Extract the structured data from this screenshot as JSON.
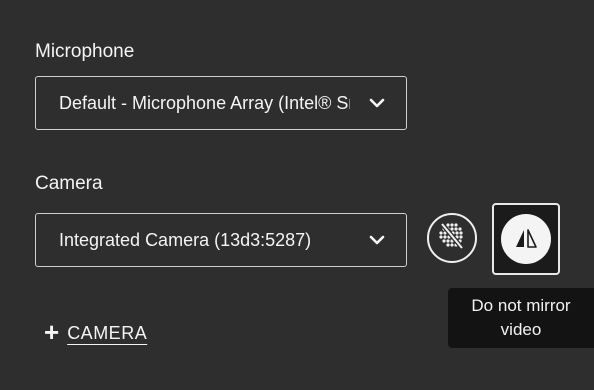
{
  "microphone": {
    "label": "Microphone",
    "selected": "Default - Microphone Array (Intel® Smart Sound Technology)"
  },
  "camera": {
    "label": "Camera",
    "selected": "Integrated Camera (13d3:5287)"
  },
  "buttons": {
    "effects_icon": "background-effects-icon",
    "mirror_icon": "mirror-icon"
  },
  "tooltip": {
    "line1": "Do not mirror",
    "line2": "video"
  },
  "add_camera": {
    "plus": "+",
    "label": "CAMERA"
  },
  "colors": {
    "background": "#2e2e2e",
    "tooltip_bg": "#131313",
    "text": "#f4f4f4",
    "border": "#cfcfcf"
  }
}
